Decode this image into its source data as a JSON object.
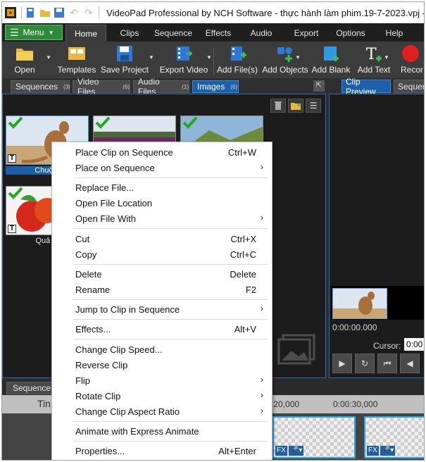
{
  "window": {
    "title": "VideoPad Professional by NCH Software - thực hành làm phim.19-7-2023.vpj -"
  },
  "menubar": {
    "menu_label": "Menu",
    "tabs": [
      "Home",
      "Clips",
      "Sequence",
      "Effects",
      "Audio",
      "Export",
      "Options",
      "Help"
    ]
  },
  "toolbar": {
    "open": "Open",
    "templates": "Templates",
    "save_project": "Save Project",
    "export_video": "Export Video",
    "add_files": "Add File(s)",
    "add_objects": "Add Objects",
    "add_blank": "Add Blank",
    "add_text": "Add Text",
    "record": "Recor"
  },
  "bins": {
    "tabs": [
      {
        "label": "Sequences",
        "count": "(3)"
      },
      {
        "label": "Video Files",
        "count": "(6)"
      },
      {
        "label": "Audio Files",
        "count": "(1)"
      },
      {
        "label": "Images",
        "count": "(6)"
      }
    ],
    "thumbs": [
      {
        "caption": "Chuột t"
      },
      {
        "caption": "Quả tá"
      }
    ]
  },
  "preview": {
    "tabs": [
      "Clip Preview",
      "Sequenc"
    ],
    "timecode": "0:00:00.000",
    "cursor_label": "Cursor:",
    "cursor_value": "0:00"
  },
  "timeline": {
    "tab": "Sequence",
    "track_label": "Tin",
    "ruler_1": ":20,000",
    "ruler_2": "0:00:30,000",
    "fx": "FX"
  },
  "context_menu": {
    "place_clip_on_sequence": {
      "label": "Place Clip on Sequence",
      "shortcut": "Ctrl+W"
    },
    "place_on_sequence": {
      "label": "Place on Sequence"
    },
    "replace_file": {
      "label": "Replace File..."
    },
    "open_file_location": {
      "label": "Open File Location"
    },
    "open_file_with": {
      "label": "Open File With"
    },
    "cut": {
      "label": "Cut",
      "shortcut": "Ctrl+X"
    },
    "copy": {
      "label": "Copy",
      "shortcut": "Ctrl+C"
    },
    "delete": {
      "label": "Delete",
      "shortcut": "Delete"
    },
    "rename": {
      "label": "Rename",
      "shortcut": "F2"
    },
    "jump_to_clip": {
      "label": "Jump to Clip in Sequence"
    },
    "effects": {
      "label": "Effects...",
      "shortcut": "Alt+V"
    },
    "change_clip_speed": {
      "label": "Change Clip Speed..."
    },
    "reverse_clip": {
      "label": "Reverse Clip"
    },
    "flip": {
      "label": "Flip"
    },
    "rotate_clip": {
      "label": "Rotate Clip"
    },
    "change_aspect": {
      "label": "Change Clip Aspect Ratio"
    },
    "animate": {
      "label": "Animate with Express Animate"
    },
    "properties": {
      "label": "Properties...",
      "shortcut": "Alt+Enter"
    }
  },
  "colors": {
    "accent_blue": "#1d5fa8",
    "menu_green": "#2e8b3a",
    "check_green": "#22aa22"
  }
}
